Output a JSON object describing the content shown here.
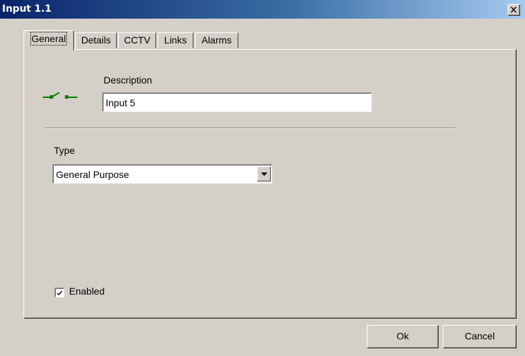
{
  "window": {
    "title": "Input 1.1",
    "close_icon": "close-icon"
  },
  "tabs": [
    {
      "label": "General",
      "active": true
    },
    {
      "label": "Details",
      "active": false
    },
    {
      "label": "CCTV",
      "active": false
    },
    {
      "label": "Links",
      "active": false
    },
    {
      "label": "Alarms",
      "active": false
    }
  ],
  "general": {
    "icon": "switch-icon",
    "description_label": "Description",
    "description_value": "Input 5",
    "type_label": "Type",
    "type_value": "General Purpose",
    "enabled_label": "Enabled",
    "enabled_checked": true
  },
  "buttons": {
    "ok": "Ok",
    "cancel": "Cancel"
  },
  "colors": {
    "titlebar_start": "#0a246a",
    "titlebar_end": "#a6caf0",
    "face": "#d4d0c8",
    "icon_green": "#008000"
  }
}
